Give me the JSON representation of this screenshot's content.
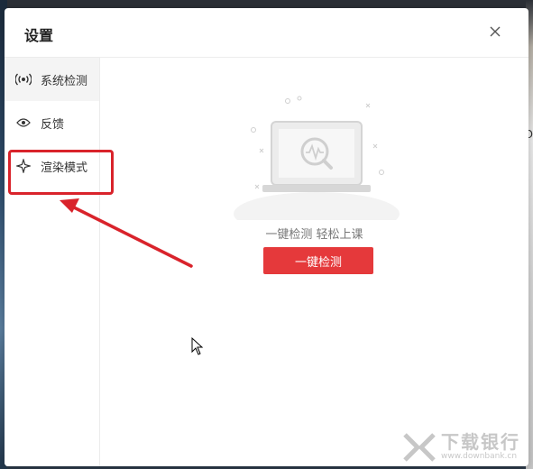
{
  "dialog": {
    "title": "设置",
    "close_icon": "close-icon"
  },
  "sidebar": {
    "items": [
      {
        "label": "系统检测",
        "icon": "broadcast-icon",
        "active": true
      },
      {
        "label": "反馈",
        "icon": "eye-icon",
        "active": false
      },
      {
        "label": "渲染模式",
        "icon": "sparkle-icon",
        "active": false
      }
    ]
  },
  "main": {
    "tagline": "一键检测 轻松上课",
    "detect_button": "一键检测"
  },
  "background": {
    "right_edge_text": "O"
  },
  "watermark": {
    "main": "下载银行",
    "sub": "www.downbank.cn"
  },
  "colors": {
    "accent": "#e5393b",
    "annotation": "#d9232b"
  }
}
